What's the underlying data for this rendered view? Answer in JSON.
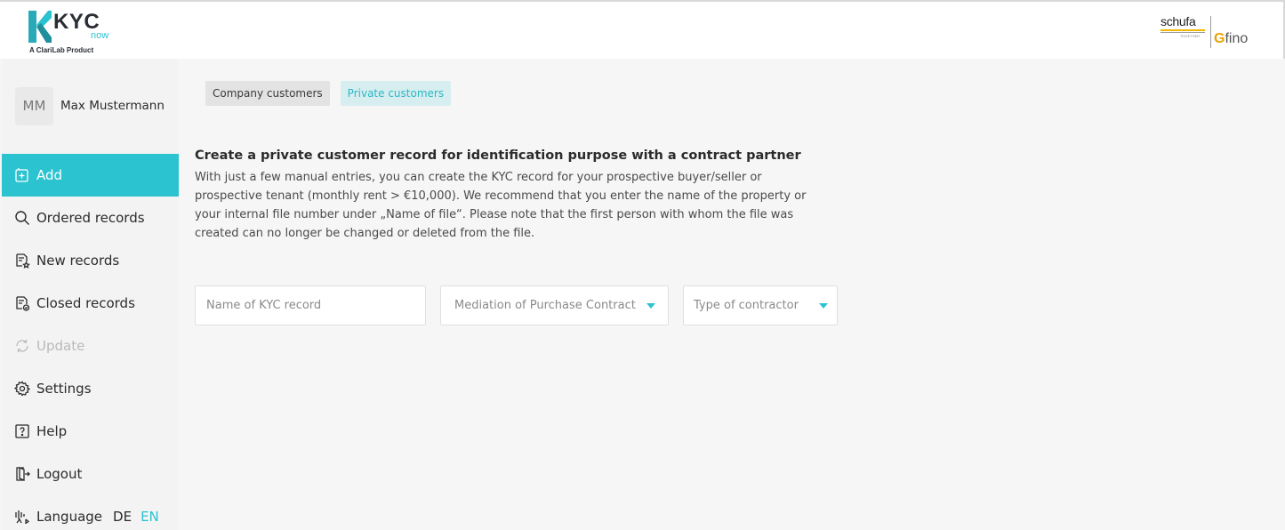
{
  "header": {
    "logo_text": "KYC",
    "logo_now": "now",
    "logo_sub": "A ClariLab Product",
    "partner_schufa": "schufa",
    "partner_together": "TOGETHER",
    "partner_fino": "fino"
  },
  "user": {
    "initials": "MM",
    "name": "Max Mustermann"
  },
  "nav": {
    "items": [
      {
        "label": "Add",
        "icon": "add-icon"
      },
      {
        "label": "Ordered records",
        "icon": "search-icon"
      },
      {
        "label": "New records",
        "icon": "new-records-icon"
      },
      {
        "label": "Closed records",
        "icon": "closed-records-icon"
      },
      {
        "label": "Update",
        "icon": "refresh-icon"
      },
      {
        "label": "Settings",
        "icon": "gear-icon"
      },
      {
        "label": "Help",
        "icon": "help-icon"
      },
      {
        "label": "Logout",
        "icon": "logout-icon"
      },
      {
        "label": "Language",
        "icon": "language-icon"
      }
    ],
    "active": "Add",
    "disabled": "Update",
    "languages": [
      "DE",
      "EN"
    ],
    "selected_language": "EN"
  },
  "tabs": {
    "company": "Company customers",
    "private": "Private customers",
    "active": "Private customers"
  },
  "content": {
    "title": "Create a private customer record for identification purpose with a contract partner",
    "description": "With just a few manual entries, you can create the KYC record for your prospective buyer/seller or prospective tenant (monthly rent > €10,000). We recommend that you enter the name of the property or your internal file number under „Name of file“. Please note that the first person with whom the file was created can no longer be changed or deleted from the file."
  },
  "form": {
    "name_placeholder": "Name of KYC record",
    "mediation_value": "Mediation of Purchase Contract",
    "contractor_placeholder": "Type of contractor"
  },
  "colors": {
    "accent": "#2cc3d0",
    "sidebar_bg": "#f3f3f3",
    "page_bg": "#f6f6f6"
  }
}
